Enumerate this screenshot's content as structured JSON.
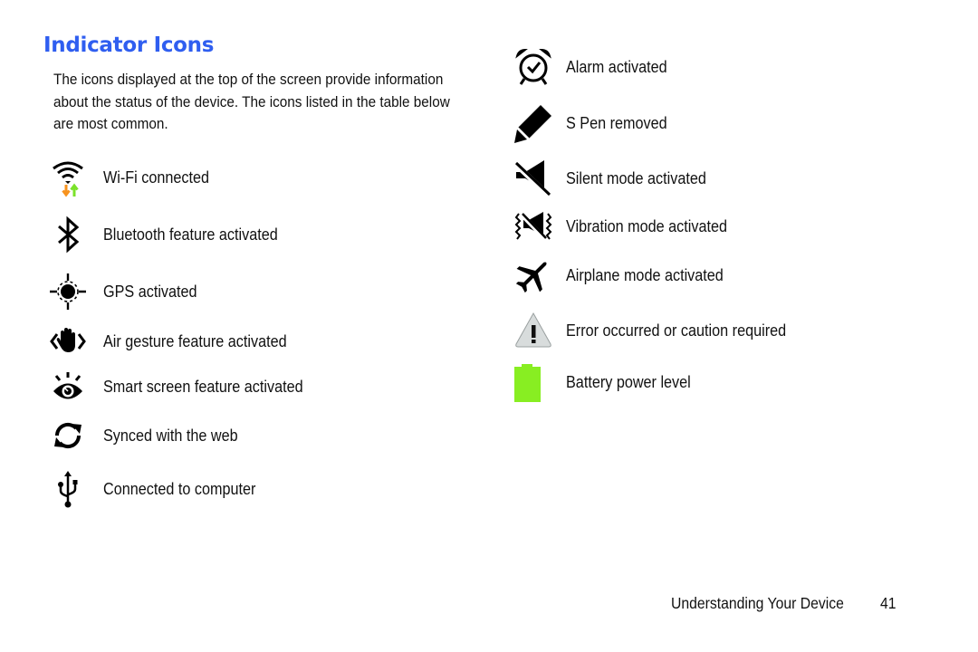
{
  "page": {
    "title": "Indicator Icons",
    "intro": "The icons displayed at the top of the screen provide information about the status of the device. The icons listed in the table below are most common."
  },
  "left_icons": [
    {
      "icon": "wifi-connected-icon",
      "label": "Wi-Fi connected"
    },
    {
      "icon": "bluetooth-icon",
      "label": "Bluetooth feature activated"
    },
    {
      "icon": "gps-icon",
      "label": "GPS activated"
    },
    {
      "icon": "air-gesture-icon",
      "label": "Air gesture feature activated"
    },
    {
      "icon": "smart-screen-eye-icon",
      "label": "Smart screen feature activated"
    },
    {
      "icon": "sync-icon",
      "label": "Synced with the web"
    },
    {
      "icon": "usb-icon",
      "label": "Connected to computer"
    }
  ],
  "right_icons": [
    {
      "icon": "alarm-clock-icon",
      "label": "Alarm activated"
    },
    {
      "icon": "s-pen-icon",
      "label": "S Pen removed"
    },
    {
      "icon": "silent-mode-icon",
      "label": "Silent mode activated"
    },
    {
      "icon": "vibration-mode-icon",
      "label": "Vibration mode activated"
    },
    {
      "icon": "airplane-icon",
      "label": "Airplane mode activated"
    },
    {
      "icon": "warning-icon",
      "label": "Error occurred or caution required"
    },
    {
      "icon": "battery-icon",
      "label": "Battery power level"
    }
  ],
  "colors": {
    "title": "#2f5ef0",
    "wifi_down_arrow": "#f7931e",
    "wifi_up_arrow": "#7be22a",
    "battery": "#88ee22",
    "warning_fill": "#d8dcdc"
  },
  "footer": {
    "section": "Understanding Your Device",
    "page_number": "41"
  }
}
